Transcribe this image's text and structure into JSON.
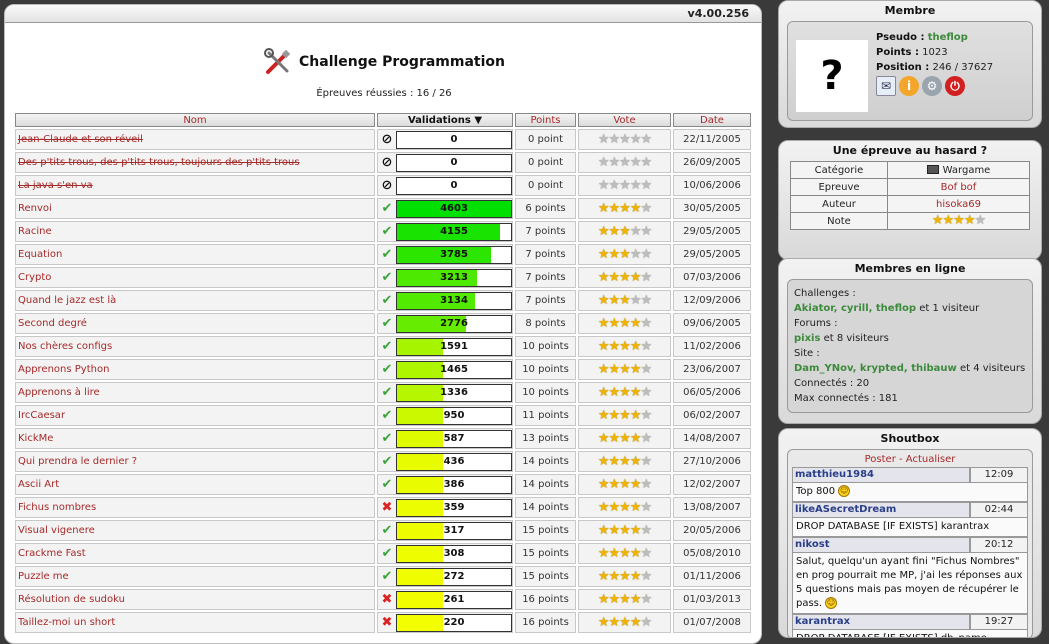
{
  "version": "v4.00.256",
  "page_title": "Challenge Programmation",
  "subtitle": "Épreuves réussies : 16 / 26",
  "columns": {
    "name": "Nom",
    "validations": "Validations ▼",
    "points": "Points",
    "vote": "Vote",
    "date": "Date"
  },
  "challenges": [
    {
      "name": "Jean-Claude et son réveil",
      "status": "none",
      "validations": 0,
      "points": "0 point",
      "stars": 0,
      "date": "22/11/2005"
    },
    {
      "name": "Des p'tits trous, des p'tits trous, toujours des p'tits trous",
      "status": "none",
      "validations": 0,
      "points": "0 point",
      "stars": 0,
      "date": "26/09/2005"
    },
    {
      "name": "La java s'en va",
      "status": "none",
      "validations": 0,
      "points": "0 point",
      "stars": 0,
      "date": "10/06/2006"
    },
    {
      "name": "Renvoi",
      "status": "ok",
      "validations": 4603,
      "points": "6 points",
      "stars": 3.5,
      "date": "30/05/2005"
    },
    {
      "name": "Racine",
      "status": "ok",
      "validations": 4155,
      "points": "7 points",
      "stars": 3,
      "date": "29/05/2005"
    },
    {
      "name": "Equation",
      "status": "ok",
      "validations": 3785,
      "points": "7 points",
      "stars": 3,
      "date": "29/05/2005"
    },
    {
      "name": "Crypto",
      "status": "ok",
      "validations": 3213,
      "points": "7 points",
      "stars": 3.5,
      "date": "07/03/2006"
    },
    {
      "name": "Quand le jazz est là",
      "status": "ok",
      "validations": 3134,
      "points": "7 points",
      "stars": 3,
      "date": "12/09/2006"
    },
    {
      "name": "Second degré",
      "status": "ok",
      "validations": 2776,
      "points": "8 points",
      "stars": 3.5,
      "date": "09/06/2005"
    },
    {
      "name": "Nos chères configs",
      "status": "ok",
      "validations": 1591,
      "points": "10 points",
      "stars": 3.5,
      "date": "11/02/2006"
    },
    {
      "name": "Apprenons Python",
      "status": "ok",
      "validations": 1465,
      "points": "10 points",
      "stars": 3.5,
      "date": "23/06/2007"
    },
    {
      "name": "Apprenons à lire",
      "status": "ok",
      "validations": 1336,
      "points": "10 points",
      "stars": 3.5,
      "date": "06/05/2006"
    },
    {
      "name": "IrcCaesar",
      "status": "ok",
      "validations": 950,
      "points": "11 points",
      "stars": 3.5,
      "date": "06/02/2007"
    },
    {
      "name": "KickMe",
      "status": "ok",
      "validations": 587,
      "points": "13 points",
      "stars": 3.5,
      "date": "14/08/2007"
    },
    {
      "name": "Qui prendra le dernier ?",
      "status": "ok",
      "validations": 436,
      "points": "14 points",
      "stars": 3.5,
      "date": "27/10/2006"
    },
    {
      "name": "Ascii Art",
      "status": "ok",
      "validations": 386,
      "points": "14 points",
      "stars": 3.5,
      "date": "12/02/2007"
    },
    {
      "name": "Fichus nombres",
      "status": "ko",
      "validations": 359,
      "points": "14 points",
      "stars": 4,
      "date": "13/08/2007"
    },
    {
      "name": "Visual vigenere",
      "status": "ok",
      "validations": 317,
      "points": "15 points",
      "stars": 3.5,
      "date": "20/05/2006"
    },
    {
      "name": "Crackme Fast",
      "status": "ok",
      "validations": 308,
      "points": "15 points",
      "stars": 3.5,
      "date": "05/08/2010"
    },
    {
      "name": "Puzzle me",
      "status": "ok",
      "validations": 272,
      "points": "15 points",
      "stars": 4,
      "date": "01/11/2006"
    },
    {
      "name": "Résolution de sudoku",
      "status": "ko",
      "validations": 261,
      "points": "16 points",
      "stars": 4,
      "date": "01/03/2013"
    },
    {
      "name": "Taillez-moi un short",
      "status": "ko",
      "validations": 220,
      "points": "16 points",
      "stars": 4,
      "date": "01/07/2008"
    }
  ],
  "membre": {
    "title": "Membre",
    "avatar": "?",
    "pseudo_label": "Pseudo :",
    "pseudo": "theflop",
    "points_label": "Points :",
    "points": "1023",
    "position_label": "Position :",
    "position": "246 / 37627",
    "icons": [
      "mail-icon",
      "profile-icon",
      "settings-icon",
      "logout-icon"
    ]
  },
  "hasard": {
    "title": "Une épreuve au hasard ?",
    "rows": [
      {
        "key": "Catégorie",
        "value": "Wargame"
      },
      {
        "key": "Epreuve",
        "value": "Bof bof"
      },
      {
        "key": "Auteur",
        "value": "hisoka69"
      },
      {
        "key": "Note",
        "value": ""
      }
    ],
    "note_stars": 4
  },
  "online": {
    "title": "Membres en ligne",
    "challenges_label": "Challenges :",
    "challenges_users": "Akiator, cyrill, theflop",
    "challenges_rest": " et 1 visiteur",
    "forums_label": "Forums :",
    "forums_users": "pixis",
    "forums_rest": " et 8 visiteurs",
    "site_label": "Site :",
    "site_users": "Dam_YNov, krypted, thibauw",
    "site_rest": " et 4 visiteurs",
    "connected": "Connectés : 20",
    "max_connected": "Max connectés : 181"
  },
  "shoutbox": {
    "title": "Shoutbox",
    "poster": "Poster",
    "sep": " - ",
    "refresh": "Actualiser",
    "messages": [
      {
        "user": "matthieu1984",
        "time": "12:09",
        "text": "Top 800",
        "smiley": true
      },
      {
        "user": "likeASecretDream",
        "time": "02:44",
        "text": "DROP DATABASE [IF EXISTS] karantrax",
        "smiley": false
      },
      {
        "user": "nikost",
        "time": "20:12",
        "text": "Salut, quelqu'un ayant fini \"Fichus Nombres\" en prog pourrait me MP, j'ai les réponses aux 5 questions mais pas moyen de récupérer le pass.",
        "smiley": true
      },
      {
        "user": "karantrax",
        "time": "19:27",
        "text": "DROP DATABASE [IF EXISTS] db_name",
        "smiley": false
      }
    ]
  },
  "colors": {
    "link": "#a52a2a",
    "member_green": "#3c8a3c",
    "bar_max": "#00e000",
    "bar_min": "#ffff00"
  }
}
